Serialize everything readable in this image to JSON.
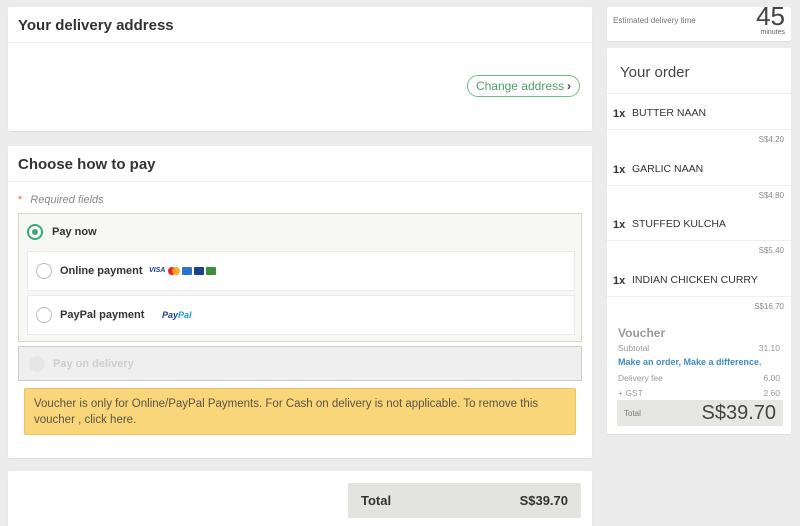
{
  "delivery": {
    "title": "Your delivery address",
    "change_label": "Change address",
    "change_chevron": "›"
  },
  "payment": {
    "title": "Choose how to pay",
    "required_star": "*",
    "required_label": "Required fields",
    "pay_now_label": "Pay now",
    "options": [
      {
        "label": "Online payment",
        "logos": [
          "VISA",
          "mastercard",
          "amex",
          "mastercard-alt",
          "JCB"
        ],
        "selected": false
      },
      {
        "label": "PayPal payment",
        "logo_part1": "Pay",
        "logo_part2": "Pal",
        "selected": false
      }
    ],
    "cod_label": "Pay on delivery",
    "voucher_note": "Voucher is only for Online/PayPal Payments. For Cash on delivery is not applicable. To remove this voucher , click here.",
    "accent_color": "#3aa875",
    "note_color": "#fad67a"
  },
  "total_bar": {
    "label": "Total",
    "value": "S$39.70"
  },
  "eta": {
    "label": "Estimated delivery time",
    "value": "45",
    "unit": "minutes"
  },
  "order": {
    "title": "Your order",
    "items": [
      {
        "qty": "1x",
        "name": "BUTTER NAAN",
        "price": "S$4.20"
      },
      {
        "qty": "1x",
        "name": "GARLIC NAAN",
        "price": "S$4.80"
      },
      {
        "qty": "1x",
        "name": "STUFFED KULCHA",
        "price": "S$5.40"
      },
      {
        "qty": "1x",
        "name": "INDIAN CHICKEN CURRY",
        "price": "S$16.70"
      }
    ],
    "voucher_title": "Voucher",
    "subtotal_label": "Subtotal",
    "subtotal_value": "31.10",
    "promo": "Make an order, Make a difference.",
    "delivery_fee_label": "Delivery fee",
    "delivery_fee_value": "6.00",
    "gst_label": "+ GST",
    "gst_value": "2.60",
    "total_label": "Total",
    "total_value": "S$39.70"
  }
}
